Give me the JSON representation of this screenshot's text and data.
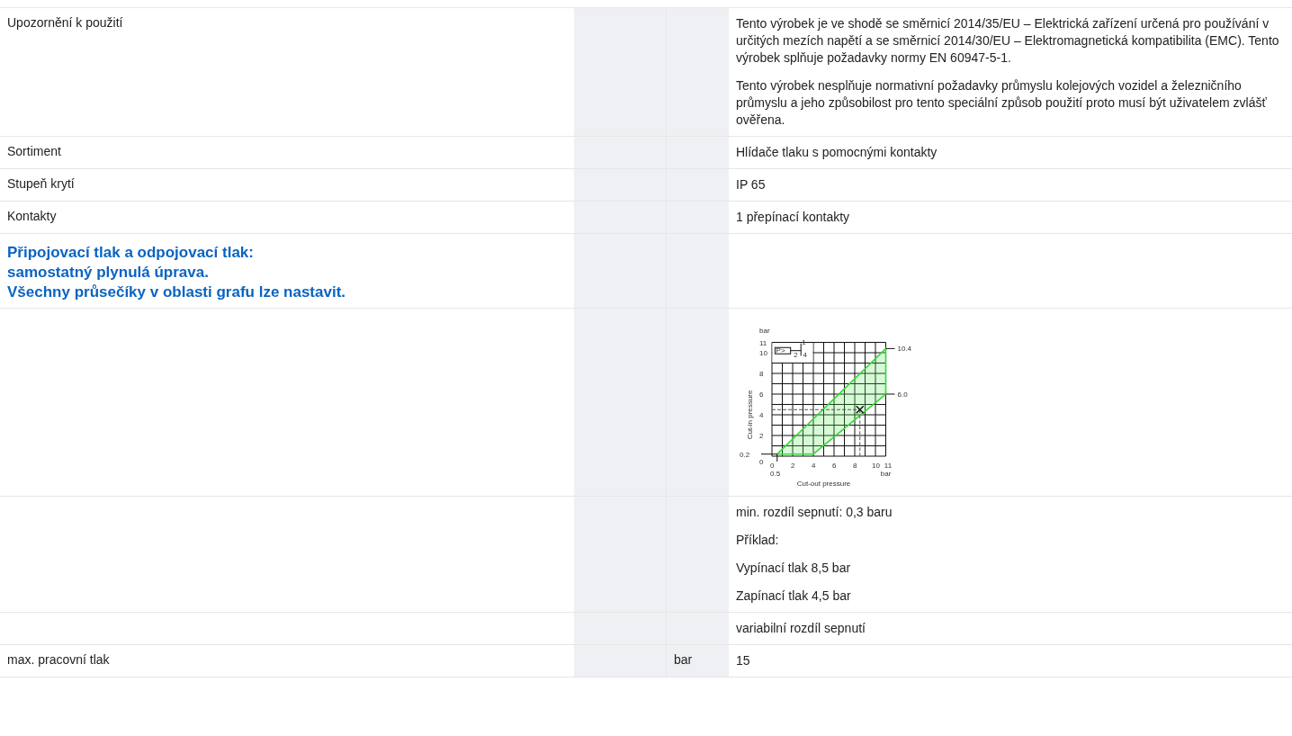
{
  "rows": [
    {
      "kind": "text",
      "label": "Upozornění k použití",
      "unit": "",
      "values": [
        "Tento výrobek je ve shodě se směrnicí 2014/35/EU – Elektrická zařízení určená pro používání v určitých mezích napětí a se směrnicí 2014/30/EU – Elektromagnetická kompatibilita (EMC). Tento výrobek splňuje požadavky normy EN 60947-5-1.",
        "Tento výrobek nesplňuje normativní požadavky průmyslu kolejových vozidel a železničního průmyslu a jeho způsobilost pro tento speciální způsob použití proto musí být uživatelem zvlášť ověřena."
      ]
    },
    {
      "kind": "text",
      "label": "Sortiment",
      "unit": "",
      "values": [
        "Hlídače tlaku s pomocnými kontakty"
      ]
    },
    {
      "kind": "text",
      "label": "Stupeň krytí",
      "unit": "",
      "values": [
        "IP 65"
      ]
    },
    {
      "kind": "text",
      "label": "Kontakty",
      "unit": "",
      "values": [
        "1 přepínací kontakty"
      ]
    },
    {
      "kind": "heading",
      "lines": [
        "Připojovací tlak a odpojovací tlak:",
        "samostatný plynulá úprava.",
        "Všechny průsečíky v oblasti grafu lze nastavit."
      ]
    },
    {
      "kind": "diagram",
      "diagram": {
        "y_unit": "bar",
        "y_ticks": [
          "11",
          "10",
          "8",
          "6",
          "4",
          "2",
          "0"
        ],
        "x_ticks": [
          "0",
          "2",
          "4",
          "6",
          "8",
          "10",
          "11"
        ],
        "x_unit": "bar",
        "x_start": "0.5",
        "y_start": "0.2",
        "right_labels": [
          "10.4",
          "6.0"
        ],
        "ylabel": "Cut-in pressure",
        "xlabel": "Cut-out pressure",
        "symbol": "P>",
        "symbol_marks": [
          "1",
          "2",
          "4"
        ]
      }
    },
    {
      "kind": "text",
      "label": "",
      "unit": "",
      "values": [
        "min. rozdíl sepnutí: 0,3 baru",
        "Příklad:",
        "Vypínací tlak 8,5 bar",
        "Zapínací tlak 4,5 bar"
      ]
    },
    {
      "kind": "text",
      "label": "",
      "unit": "",
      "values": [
        "variabilní rozdíl sepnutí"
      ]
    },
    {
      "kind": "text",
      "label": "max. pracovní tlak",
      "unit": "bar",
      "values": [
        "15"
      ]
    }
  ]
}
